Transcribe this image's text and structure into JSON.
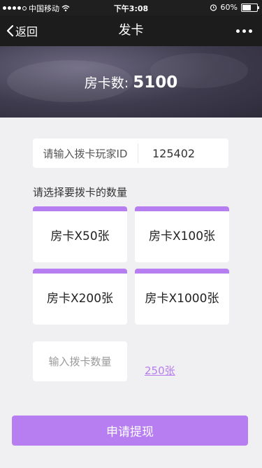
{
  "status_bar": {
    "carrier": "中国移动",
    "time": "下午3:08",
    "battery": "60%",
    "battery_level": 0.6
  },
  "nav": {
    "back_label": "返回",
    "title": "发卡"
  },
  "banner": {
    "label": "房卡数:",
    "value": "5100"
  },
  "id_field": {
    "label": "请输入拨卡玩家ID",
    "value": "125402"
  },
  "section_title": "请选择要拨卡的数量",
  "options": [
    {
      "label": "房卡X50张"
    },
    {
      "label": "房卡X100张"
    },
    {
      "label": "房卡X200张"
    },
    {
      "label": "房卡X1000张"
    }
  ],
  "quantity": {
    "placeholder": "输入拨卡数量",
    "link_text": "250张"
  },
  "submit_label": "申请提现",
  "colors": {
    "accent": "#b77ef1",
    "header": "#1c1c1c",
    "background": "#f0eff1"
  }
}
